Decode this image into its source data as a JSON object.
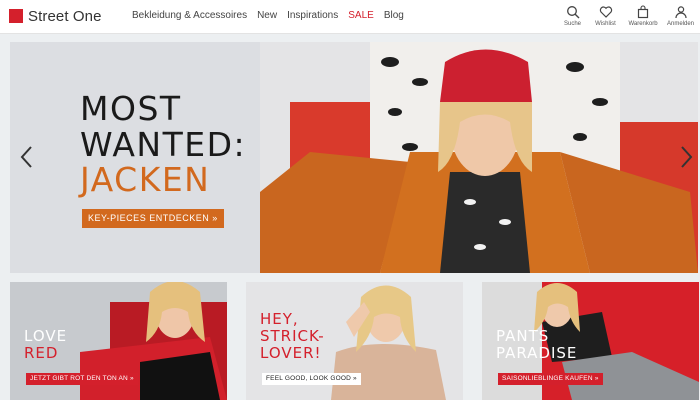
{
  "brand": {
    "name": "Street One",
    "color": "#d4202c"
  },
  "nav": [
    {
      "label": "Bekleidung & Accessoires"
    },
    {
      "label": "New"
    },
    {
      "label": "Inspirations"
    },
    {
      "label": "SALE"
    },
    {
      "label": "Blog"
    }
  ],
  "actions": [
    {
      "label": "Suche",
      "icon": "search-icon"
    },
    {
      "label": "Wishlist",
      "icon": "heart-icon"
    },
    {
      "label": "Warenkorb",
      "icon": "bag-icon"
    },
    {
      "label": "Anmelden",
      "icon": "user-icon"
    }
  ],
  "hero": {
    "title_line1": "MOST",
    "title_line2": "WANTED:",
    "title_line3": "JACKEN",
    "cta": "KEY-PIECES ENTDECKEN »",
    "accent": "#d2691e"
  },
  "tiles": [
    {
      "title_line1": "LOVE",
      "title_line2": "RED",
      "cta": "JETZT GIBT ROT DEN TON AN »"
    },
    {
      "title_line1": "HEY,",
      "title_line2": "STRICK-",
      "title_line3": "LOVER!",
      "cta": "FEEL GOOD, LOOK GOOD »"
    },
    {
      "title_line1": "PANTS",
      "title_line2": "PARADISE",
      "cta": "SAISONLIEBLINGE KAUFEN »"
    }
  ]
}
